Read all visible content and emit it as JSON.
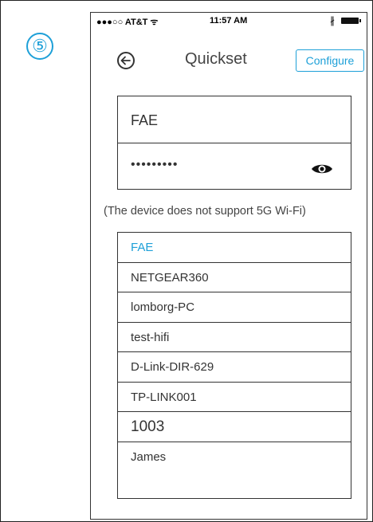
{
  "step_number": "⑤",
  "status_bar": {
    "carrier": "●●●○○ AT&T ᯤ",
    "time": "11:57 AM",
    "bluetooth": "∦"
  },
  "header": {
    "title": "Quickset",
    "configure_label": "Configure"
  },
  "credentials": {
    "ssid": "FAE",
    "password": "•••••••••"
  },
  "notice": "(The device does not support 5G Wi-Fi)",
  "networks": [
    "FAE",
    "NETGEAR360",
    "lomborg-PC",
    "test-hifi",
    "D-Link-DIR-629",
    "TP-LINK001",
    "1003",
    "James"
  ],
  "colors": {
    "accent": "#1ea0d8",
    "border": "#333333",
    "text": "#333333"
  },
  "icons": {
    "back": "back-arrow-icon",
    "eye": "eye-icon",
    "bluetooth": "bluetooth-icon",
    "battery": "battery-icon"
  }
}
